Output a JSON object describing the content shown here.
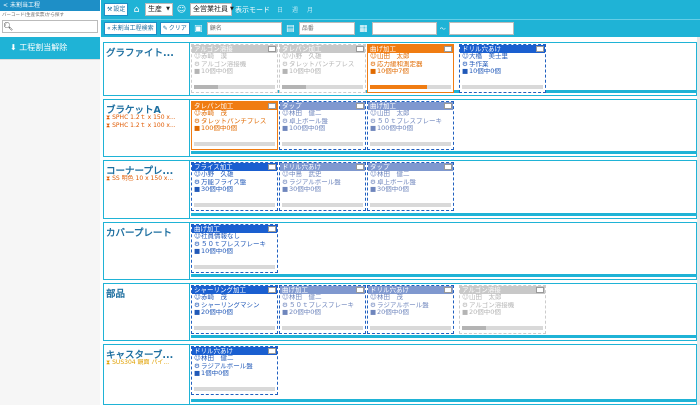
{
  "left": {
    "header": "未割当工程",
    "hint": "バーコード(生産伝票)から探す",
    "search_placeholder": "",
    "item_label": "工程割当解除"
  },
  "toolbar": {
    "settings_label": "設定",
    "factory_value": "生産",
    "staff_value": "全営業社員",
    "display_mode_label": "表示モード",
    "day_labels": [
      "日",
      "週",
      "月"
    ],
    "filter_label": "未割当工程検索",
    "clear_label": "クリア",
    "customer_placeholder": "顧名",
    "product_placeholder": "品番",
    "date_from": "",
    "date_sep": "〜",
    "date_to": ""
  },
  "rows": [
    {
      "title": "グラファイト...",
      "materials": [],
      "cards": [
        {
          "style": "gray",
          "title": "アルゴン溶接",
          "person": "赤崎　漠",
          "machine": "アルゴン溶接機",
          "qty": "10個中0個",
          "progress": 0.3
        },
        {
          "style": "gray",
          "title": "タレパン加工",
          "person": "小野　久雄",
          "machine": "タレットパンチプレス",
          "qty": "10個中0個",
          "progress": 0.3
        },
        {
          "style": "orange",
          "title": "曲げ加工",
          "person": "山田　太郎",
          "machine": "応力緩和測定器",
          "qty": "10個中7個",
          "progress": 0.7
        },
        {
          "style": "blue",
          "title": "ドリル穴あけ",
          "person": "大橋　美士里",
          "machine": "手作業",
          "qty": "10個中0個",
          "progress": 0.0
        }
      ]
    },
    {
      "title": "ブラケットA",
      "materials": [
        "SPHC 1.2ｔ x 150 x...",
        "SPHC 1.2ｔ x 100 x..."
      ],
      "mat_color": "orange",
      "cards": [
        {
          "style": "orange",
          "title": "タレパン加工",
          "person": "赤崎　茂",
          "machine": "タレットパンチプレス",
          "qty": "100個中0個",
          "progress": 0.0
        },
        {
          "style": "lblue",
          "title": "タップ",
          "person": "林田　健二",
          "machine": "卓上ボール盤",
          "qty": "100個中0個",
          "progress": 0.0
        },
        {
          "style": "lblue",
          "title": "曲げ加工",
          "person": "山田　太郎",
          "machine": "５０ｔプレスブレーキ",
          "qty": "100個中0個",
          "progress": 0.0
        }
      ]
    },
    {
      "title": "コーナープレ...",
      "materials": [
        "SS 明色 10 x 150 x..."
      ],
      "mat_color": "orange",
      "cards": [
        {
          "style": "blue",
          "title": "フライス加工",
          "person": "小野　久雄",
          "machine": "万能フライス盤",
          "qty": "30個中0個",
          "progress": 0.0
        },
        {
          "style": "lblue",
          "title": "ドリル穴あけ",
          "person": "中島　武史",
          "machine": "ラジアルボール盤",
          "qty": "30個中0個",
          "progress": 0.0
        },
        {
          "style": "lblue",
          "title": "タップ",
          "person": "林田　健二",
          "machine": "卓上ボール盤",
          "qty": "30個中0個",
          "progress": 0.0
        }
      ]
    },
    {
      "title": "カバープレート",
      "materials": [],
      "cards": [
        {
          "style": "blue",
          "title": "曲げ加工",
          "person": "社員情報なし",
          "machine": "５０ｔプレスブレーキ",
          "qty": "10個中0個",
          "progress": 0.0
        }
      ]
    },
    {
      "title": "部品",
      "materials": [],
      "cards": [
        {
          "style": "blue",
          "title": "シャーリング加工",
          "person": "赤崎　茂",
          "machine": "シャーリングマシン",
          "qty": "20個中0個",
          "progress": 0.0
        },
        {
          "style": "lblue",
          "title": "曲げ加工",
          "person": "林田　健二",
          "machine": "５０ｔプレスブレーキ",
          "qty": "20個中0個",
          "progress": 0.0
        },
        {
          "style": "lblue",
          "title": "ドリル穴あけ",
          "person": "林田　茂",
          "machine": "ラジアルボール盤",
          "qty": "20個中0個",
          "progress": 0.0
        },
        {
          "style": "gray",
          "title": "アルゴン溶接",
          "person": "山田　太郎",
          "machine": "アルゴン溶接機",
          "qty": "20個中0個",
          "progress": 0.3
        }
      ]
    },
    {
      "title": "キャスターブ...",
      "materials": [
        "SUS304 鏡面 パイ..."
      ],
      "mat_color": "yellow",
      "cards": [
        {
          "style": "blue",
          "title": "ドリル穴あけ",
          "person": "林田　健二",
          "machine": "ラジアルボール盤",
          "qty": "1個中0個",
          "progress": 0.0
        }
      ]
    }
  ]
}
